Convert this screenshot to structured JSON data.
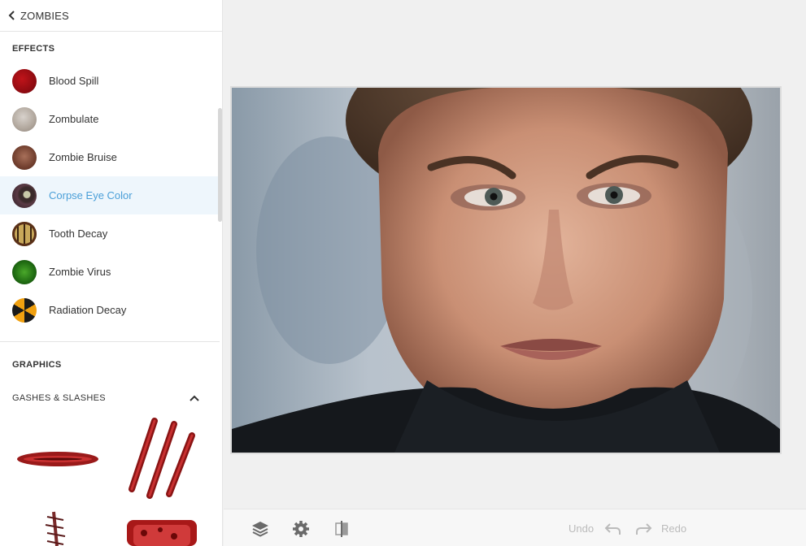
{
  "sidebar": {
    "back_title": "ZOMBIES",
    "effects_label": "EFFECTS",
    "effects": [
      {
        "label": "Blood Spill",
        "active": false
      },
      {
        "label": "Zombulate",
        "active": false
      },
      {
        "label": "Zombie Bruise",
        "active": false
      },
      {
        "label": "Corpse Eye Color",
        "active": true
      },
      {
        "label": "Tooth Decay",
        "active": false
      },
      {
        "label": "Zombie Virus",
        "active": false
      },
      {
        "label": "Radiation Decay",
        "active": false
      }
    ],
    "graphics_label": "GRAPHICS",
    "gashes_label": "GASHES & SLASHES"
  },
  "toolbar": {
    "undo_label": "Undo",
    "redo_label": "Redo",
    "icons": [
      "layers-icon",
      "gear-icon",
      "compare-icon",
      "undo-arrow-icon",
      "redo-arrow-icon"
    ]
  },
  "colors": {
    "accent": "#4a9fd8",
    "active_row": "#eef6fc",
    "disabled_text": "#bbbbbb"
  }
}
